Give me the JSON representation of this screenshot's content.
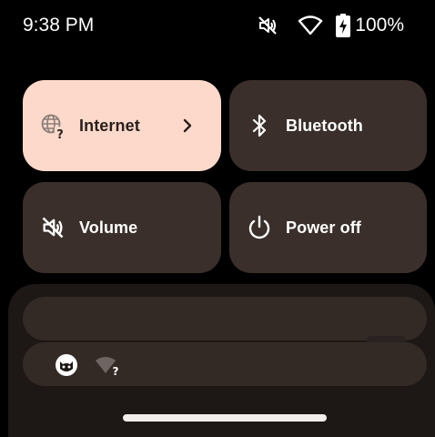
{
  "status_bar": {
    "time": "9:38 PM",
    "battery_percent": "100%",
    "icons": [
      "volume-mute-icon",
      "wifi-icon",
      "battery-charging-icon"
    ]
  },
  "quick_settings": {
    "tiles": [
      {
        "label": "Internet",
        "icon": "internet-globe-icon",
        "active": true,
        "has_chevron": true
      },
      {
        "label": "Bluetooth",
        "icon": "bluetooth-icon",
        "active": false
      },
      {
        "label": "Volume",
        "icon": "volume-mute-icon",
        "active": false
      },
      {
        "label": "Power off",
        "icon": "power-icon",
        "active": false
      }
    ]
  },
  "notification_shade": {
    "icons": [
      "cat-face-icon",
      "wifi-unknown-icon"
    ]
  },
  "colors": {
    "background": "#000000",
    "tile_inactive": "#3a2f2b",
    "tile_active": "#fcd9cb",
    "sheet": "#1d1715",
    "sheet_bar": "#332a26",
    "nav_handle": "#f2eeec"
  }
}
